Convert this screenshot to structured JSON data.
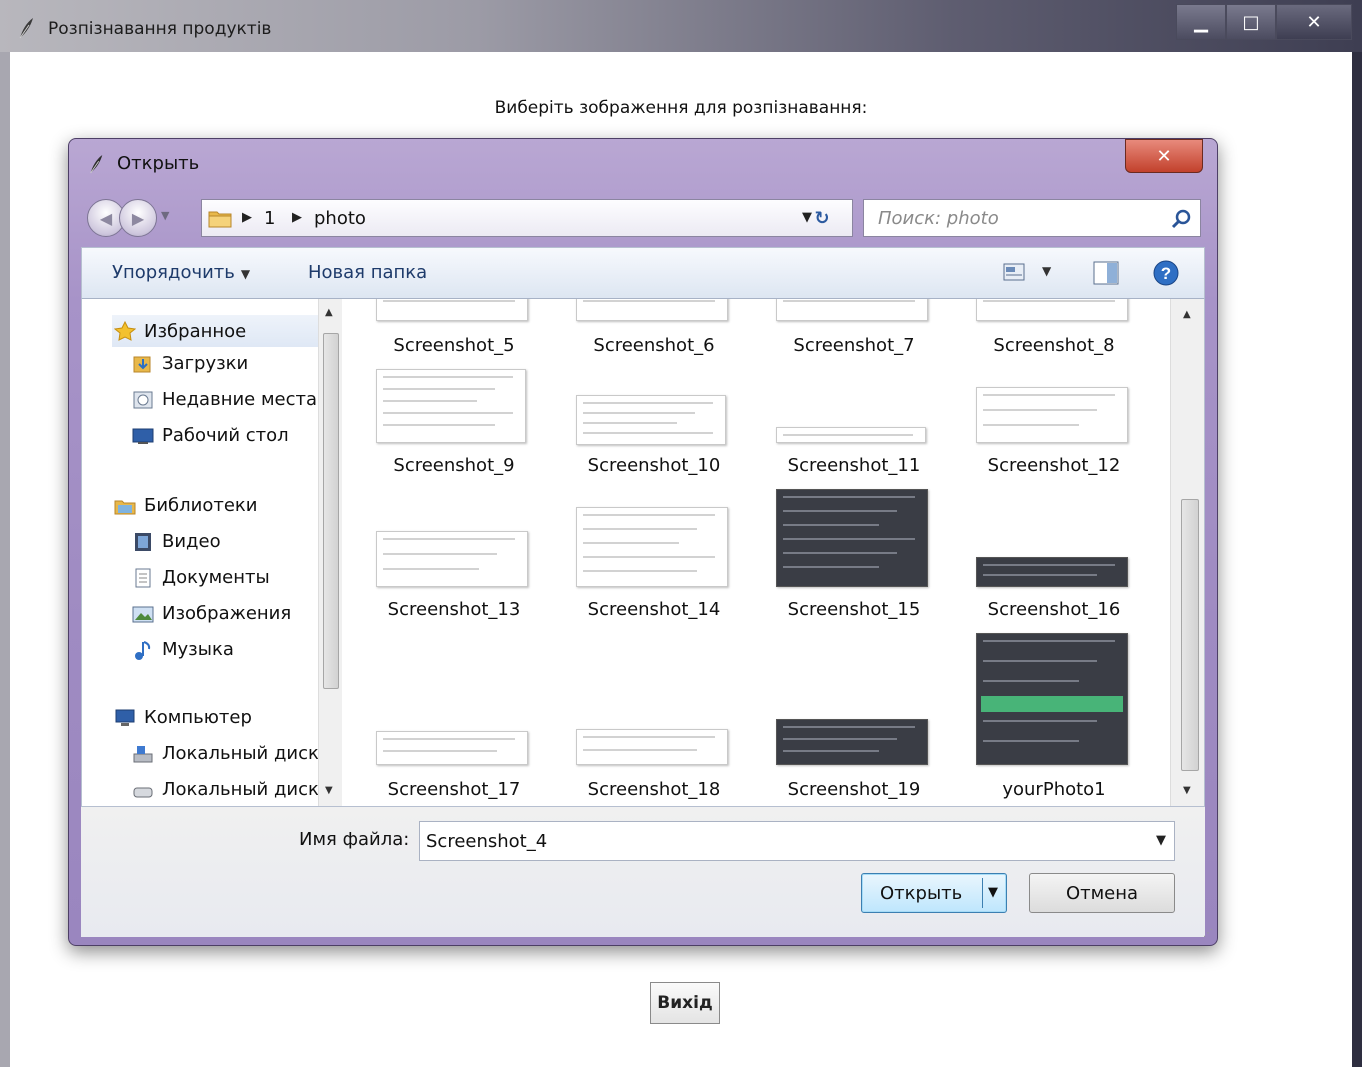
{
  "app": {
    "title": "Розпізнавання продуктів",
    "prompt": "Виберіть зображення для розпізнавання:",
    "exit_button": "Вихід",
    "window_buttons": {
      "minimize": "▁",
      "maximize": "□",
      "close": "✕"
    }
  },
  "dialog": {
    "title": "Открыть",
    "close": "✕",
    "breadcrumb": [
      "1",
      "photo"
    ],
    "search_placeholder": "Поиск: photo",
    "toolbar": {
      "organize": "Упорядочить",
      "new_folder": "Новая папка"
    },
    "nav_items": [
      {
        "label": "Избранное",
        "icon": "star-icon"
      },
      {
        "label": "Загрузки",
        "icon": "downloads-icon"
      },
      {
        "label": "Недавние места",
        "icon": "recent-places-icon"
      },
      {
        "label": "Рабочий стол",
        "icon": "desktop-icon"
      },
      {
        "label": "Библиотеки",
        "icon": "libraries-icon"
      },
      {
        "label": "Видео",
        "icon": "video-icon"
      },
      {
        "label": "Документы",
        "icon": "documents-icon"
      },
      {
        "label": "Изображения",
        "icon": "pictures-icon"
      },
      {
        "label": "Музыка",
        "icon": "music-icon"
      },
      {
        "label": "Компьютер",
        "icon": "computer-icon"
      },
      {
        "label": "Локальный диск",
        "icon": "local-disk-icon"
      },
      {
        "label": "Локальный диск",
        "icon": "drive-icon"
      }
    ],
    "files": [
      "Screenshot_5",
      "Screenshot_6",
      "Screenshot_7",
      "Screenshot_8",
      "Screenshot_9",
      "Screenshot_10",
      "Screenshot_11",
      "Screenshot_12",
      "Screenshot_13",
      "Screenshot_14",
      "Screenshot_15",
      "Screenshot_16",
      "Screenshot_17",
      "Screenshot_18",
      "Screenshot_19",
      "yourPhoto1"
    ],
    "filename_label": "Имя файла:",
    "filename_value": "Screenshot_4",
    "open_button": "Открыть",
    "cancel_button": "Отмена"
  },
  "colors": {
    "dialog_frame": "#a793c8",
    "open_button": "#bee6fd",
    "close_button": "#c2412c"
  }
}
